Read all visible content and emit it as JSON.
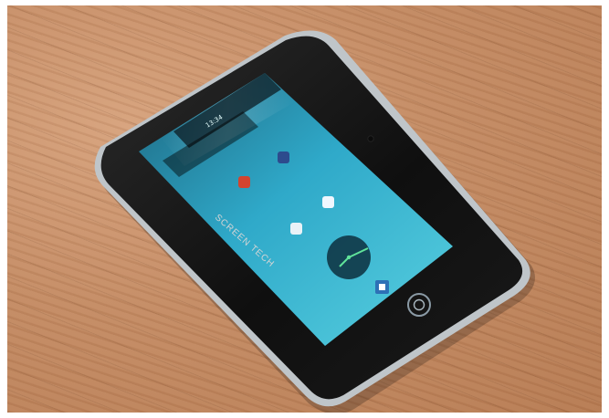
{
  "scene": {
    "description_tag": "tablet-on-wooden-table",
    "colors": {
      "wood": "#c58b64",
      "bezel": "#111111",
      "screen": "#2fa9c9",
      "clock_face": "#103a49",
      "clock_hands": "#60e39a"
    }
  },
  "tablet": {
    "brand_text": "SCREEN TECH",
    "status_bar": {
      "time": "13:34"
    },
    "clock": {
      "hour": 7,
      "minute": 22
    }
  }
}
